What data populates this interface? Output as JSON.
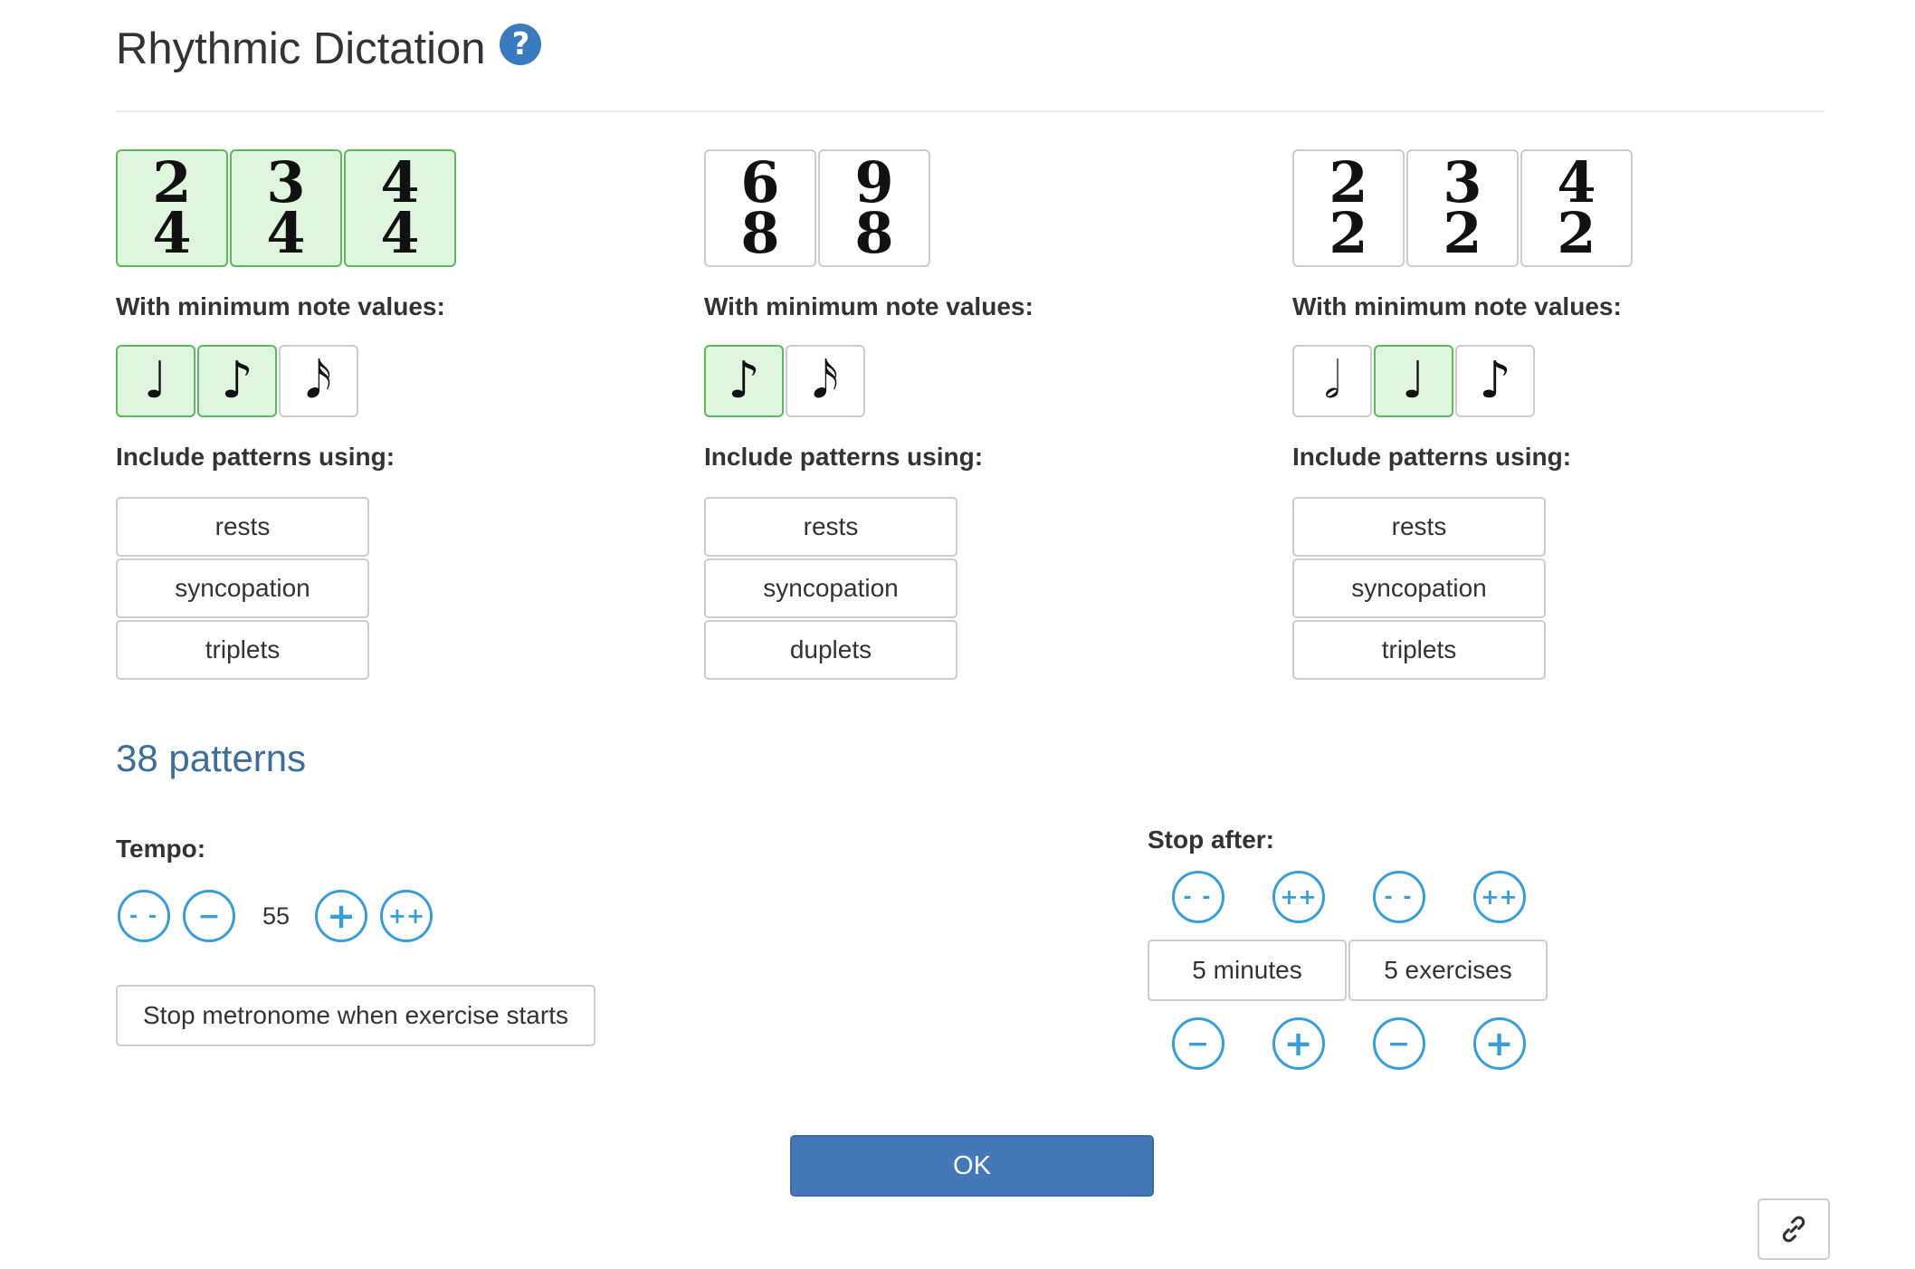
{
  "page": {
    "title": "Rhythmic Dictation",
    "help_icon": "?",
    "link_icon": "link-icon"
  },
  "columns": [
    {
      "time_signatures": [
        {
          "top": "2",
          "bottom": "4",
          "selected": true
        },
        {
          "top": "3",
          "bottom": "4",
          "selected": true
        },
        {
          "top": "4",
          "bottom": "4",
          "selected": true
        }
      ],
      "min_label": "With minimum note values:",
      "notes": [
        {
          "glyph": "♩",
          "icon": "quarter-note-icon",
          "selected": true
        },
        {
          "glyph": "♪",
          "icon": "eighth-note-icon",
          "selected": true
        },
        {
          "glyph": "𝅘𝅥𝅯",
          "icon": "sixteenth-note-icon",
          "selected": false
        }
      ],
      "include_label": "Include patterns using:",
      "patterns": [
        "rests",
        "syncopation",
        "triplets"
      ]
    },
    {
      "time_signatures": [
        {
          "top": "6",
          "bottom": "8",
          "selected": false
        },
        {
          "top": "9",
          "bottom": "8",
          "selected": false
        }
      ],
      "min_label": "With minimum note values:",
      "notes": [
        {
          "glyph": "♪",
          "icon": "eighth-note-icon",
          "selected": true
        },
        {
          "glyph": "𝅘𝅥𝅯",
          "icon": "sixteenth-note-icon",
          "selected": false
        }
      ],
      "include_label": "Include patterns using:",
      "patterns": [
        "rests",
        "syncopation",
        "duplets"
      ]
    },
    {
      "time_signatures": [
        {
          "top": "2",
          "bottom": "2",
          "selected": false
        },
        {
          "top": "3",
          "bottom": "2",
          "selected": false
        },
        {
          "top": "4",
          "bottom": "2",
          "selected": false
        }
      ],
      "min_label": "With minimum note values:",
      "notes": [
        {
          "glyph": "𝅗𝅥",
          "icon": "half-note-icon",
          "selected": false
        },
        {
          "glyph": "♩",
          "icon": "quarter-note-icon",
          "selected": true
        },
        {
          "glyph": "♪",
          "icon": "eighth-note-icon",
          "selected": false
        }
      ],
      "include_label": "Include patterns using:",
      "patterns": [
        "rests",
        "syncopation",
        "triplets"
      ]
    }
  ],
  "pattern_count": "38 patterns",
  "tempo": {
    "label": "Tempo:",
    "value": "55",
    "dec_big": "- -",
    "dec": "−",
    "inc": "+",
    "inc_big": "++",
    "metronome_button": "Stop metronome when exercise starts"
  },
  "stop_after": {
    "label": "Stop after:",
    "minutes": "5 minutes",
    "exercises": "5 exercises",
    "dec_big": "- -",
    "inc_big": "++",
    "dec": "−",
    "inc": "+"
  },
  "ok_button": "OK",
  "colors": {
    "selected_bg": "#dff5de",
    "selected_border": "#5cb85c",
    "accent": "#3a9ed6",
    "primary": "#4478b7",
    "count_text": "#3d6d99"
  }
}
